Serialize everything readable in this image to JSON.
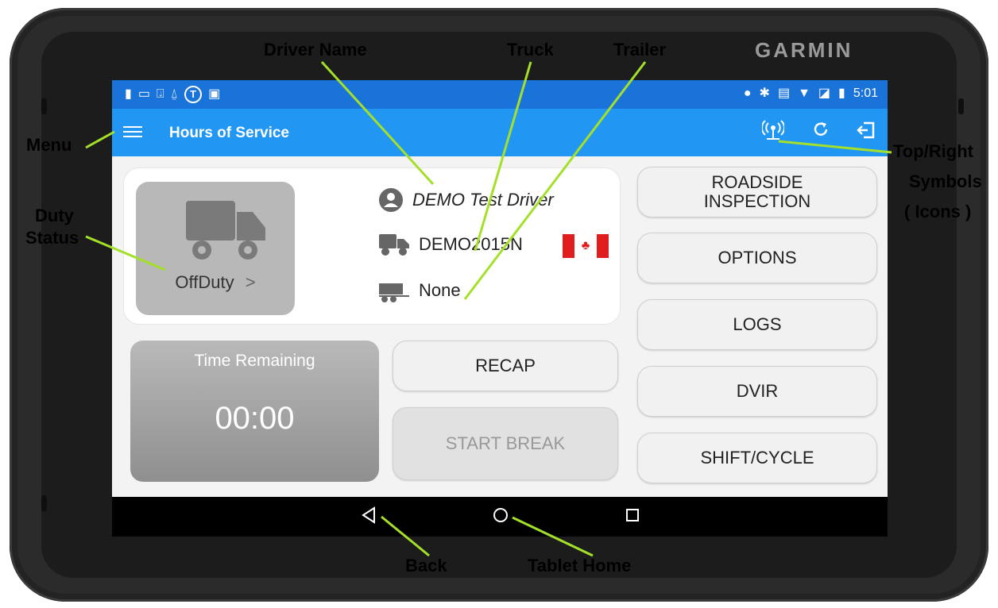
{
  "device": {
    "brand": "GARMIN"
  },
  "status_bar": {
    "left_icons": [
      "battery-small-icon",
      "toggle-icon",
      "download-icon",
      "antenna-icon",
      "t-logo-icon",
      "image-icon"
    ],
    "right_icons": [
      "location-icon",
      "bluetooth-icon",
      "cast-icon",
      "wifi-icon",
      "no-sim-icon",
      "battery-charging-icon"
    ],
    "time": "5:01"
  },
  "app_bar": {
    "title": "Hours of Service",
    "icons": [
      "menu-icon",
      "antenna-icon",
      "refresh-icon",
      "logout-icon"
    ]
  },
  "driver_card": {
    "duty_status": "OffDuty",
    "duty_chevron": ">",
    "driver_name": "DEMO Test Driver",
    "truck": "DEMO2015N",
    "trailer": "None"
  },
  "time_card": {
    "label": "Time Remaining",
    "value": "00:00"
  },
  "buttons": {
    "recap": "RECAP",
    "start_break": "START BREAK",
    "roadside_1": "ROADSIDE",
    "roadside_2": "INSPECTION",
    "options": "OPTIONS",
    "logs": "LOGS",
    "dvir": "DVIR",
    "shift_cycle": "SHIFT/CYCLE"
  },
  "nav_bar": {
    "icons": [
      "back-icon",
      "home-icon",
      "recents-icon"
    ]
  },
  "annotations": {
    "driver_name": "Driver Name",
    "truck": "Truck",
    "trailer": "Trailer",
    "menu": "Menu",
    "duty_1": "Duty",
    "duty_2": "Status",
    "top_right_1": "Top/Right",
    "top_right_2": "Symbols",
    "top_right_3": "( Icons )",
    "back": "Back",
    "tablet_home": "Tablet Home"
  },
  "colors": {
    "status_bar": "#1a73d9",
    "app_bar": "#2196f3",
    "annotation_line": "#a4e02a",
    "canada_red": "#e01d1d"
  }
}
